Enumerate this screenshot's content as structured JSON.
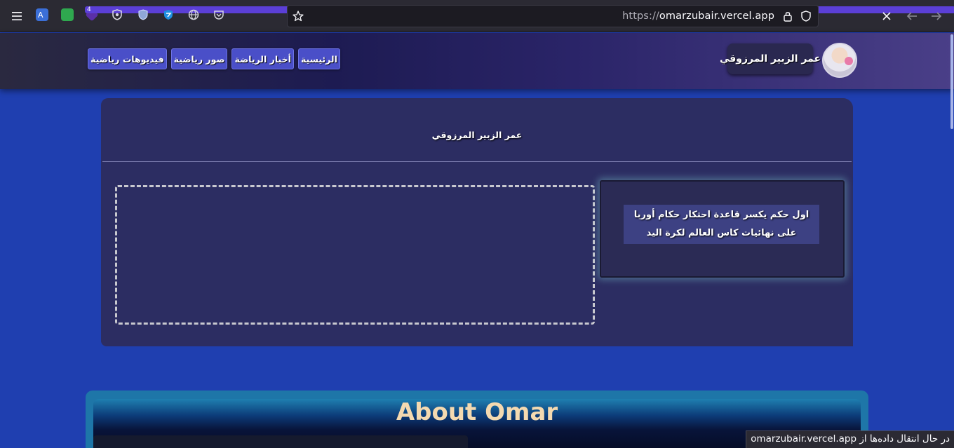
{
  "browser": {
    "url_protocol": "https://",
    "url_host": "omarzubair.vercel.app",
    "extension_badge": "4",
    "status_text": "در حال انتقال داده‌ها از omarzubair.vercel.app"
  },
  "header": {
    "brand_name": "عمر الزبير المرزوقي",
    "nav": [
      {
        "label": "الرئيسية"
      },
      {
        "label": "أخبار الرياضة"
      },
      {
        "label": "صور رياضية"
      },
      {
        "label": "فيديوهات رياضية"
      }
    ]
  },
  "card": {
    "title": "عمر الزبير المرزوقي",
    "news_headline": "اول حكم يكسر قاعدة احتكار حكام أوربا على نهائيات كاس العالم لكرة اليد"
  },
  "about": {
    "title": "About Omar"
  },
  "colors": {
    "page_bg": "#1f3fb0",
    "nav_button": "#4a4fc8",
    "card_bg": "#2c2d62",
    "about_title": "#f4d9b0"
  }
}
